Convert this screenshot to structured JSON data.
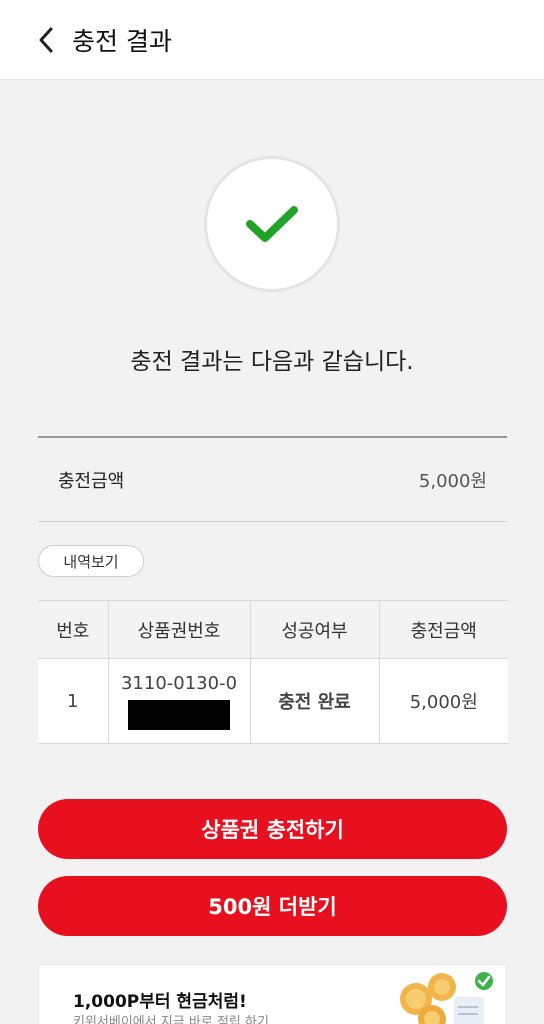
{
  "header": {
    "title": "충전 결과"
  },
  "result": {
    "message": "충전 결과는 다음과 같습니다."
  },
  "summary": {
    "label": "충전금액",
    "value": "5,000원"
  },
  "history_button": "내역보기",
  "table": {
    "headers": [
      "번호",
      "상품권번호",
      "성공여부",
      "충전금액"
    ],
    "rows": [
      {
        "no": "1",
        "code": "3110-0130-0",
        "status": "충전 완료",
        "amount": "5,000원"
      }
    ]
  },
  "buttons": {
    "charge": "상품권 충전하기",
    "bonus": "500원 더받기"
  },
  "banner": {
    "title": "1,000P부터 현금처럼!",
    "subtitle": "키위서베이에서 지금 바로 적립 하기"
  },
  "colors": {
    "accent": "#e8101e",
    "success": "#1fb5a6",
    "check": "#21a32a"
  },
  "icons": {
    "back": "chevron-left-icon",
    "success": "checkmark-icon",
    "banner": "coins-illustration"
  }
}
